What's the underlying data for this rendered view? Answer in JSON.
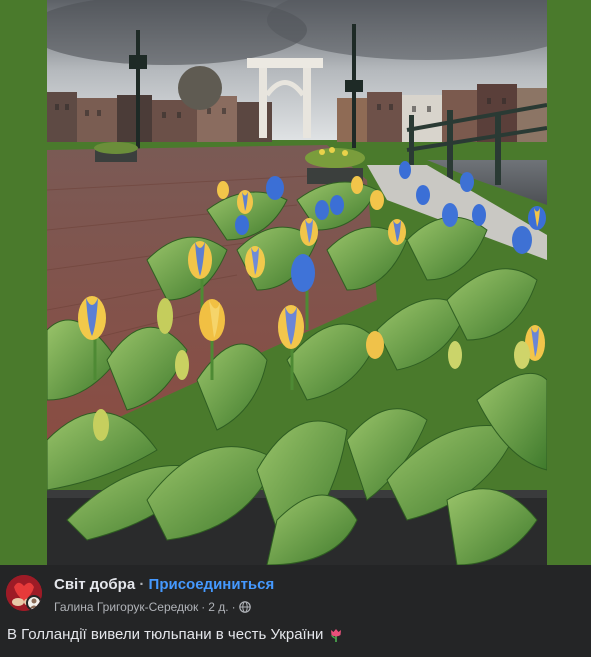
{
  "post": {
    "group_name": "Світ добра",
    "separator": "·",
    "join_label": "Присоединиться",
    "author": "Галина Григорук-Середюк",
    "time": "2 д.",
    "text": "В Голландії вивели тюльпани в честь України",
    "emoji_icon": "tulip-icon",
    "privacy_icon": "globe-icon"
  },
  "colors": {
    "background": "#242526",
    "frame_green": "#4a7a2c",
    "link_blue": "#4599ff",
    "primary_text": "#e4e6eb",
    "secondary_text": "#b0b3b8"
  }
}
